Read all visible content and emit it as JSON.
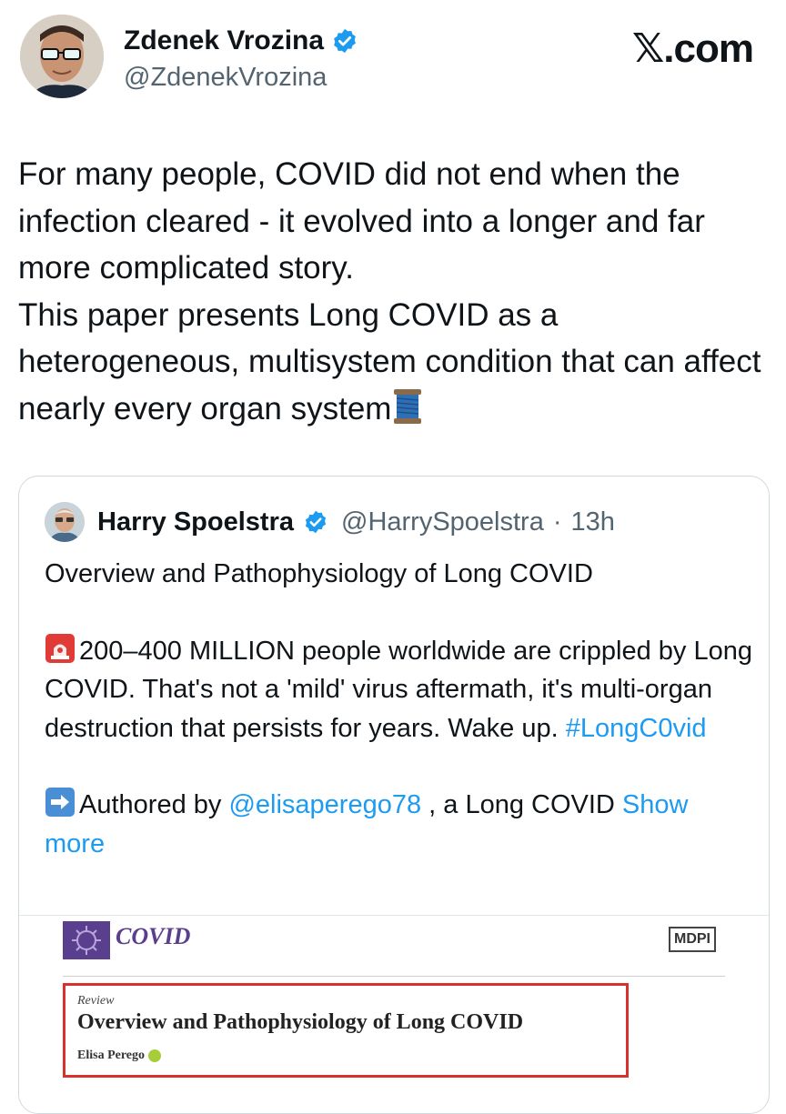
{
  "post": {
    "author_name": "Zdenek Vrozina",
    "author_handle": "@ZdenekVrozina",
    "source_logo": "𝕏.com",
    "text_lines": [
      "For many people, COVID did not end when the infection cleared - it evolved into a longer and far more complicated story.",
      "This paper presents Long COVID as a heterogeneous, multisystem condition that can affect nearly every organ system"
    ],
    "trailing_emoji": "spool-of-thread-icon"
  },
  "quote": {
    "author_name": "Harry Spoelstra",
    "author_handle": "@HarrySpoelstra",
    "separator": "·",
    "time": "13h",
    "title_line": "Overview and Pathophysiology of Long COVID",
    "para1_text": "200–400 MILLION people worldwide are crippled by Long COVID. That's not a 'mild' virus aftermath, it's multi-organ destruction that persists for years. Wake up. ",
    "para1_hashtag": "#LongC0vid",
    "para2_prefix": "Authored by ",
    "para2_mention": "@elisaperego78",
    "para2_suffix": " , a Long COVID ",
    "show_more": "Show more"
  },
  "document": {
    "journal": "COVID",
    "publisher": "MDPI",
    "article_type": "Review",
    "title": "Overview and Pathophysiology of Long COVID",
    "author": "Elisa Perego"
  },
  "colors": {
    "link": "#1d9bf0",
    "verified": "#1d9bf0",
    "highlight_border": "#d6312c",
    "journal_purple": "#5b3f8f"
  }
}
